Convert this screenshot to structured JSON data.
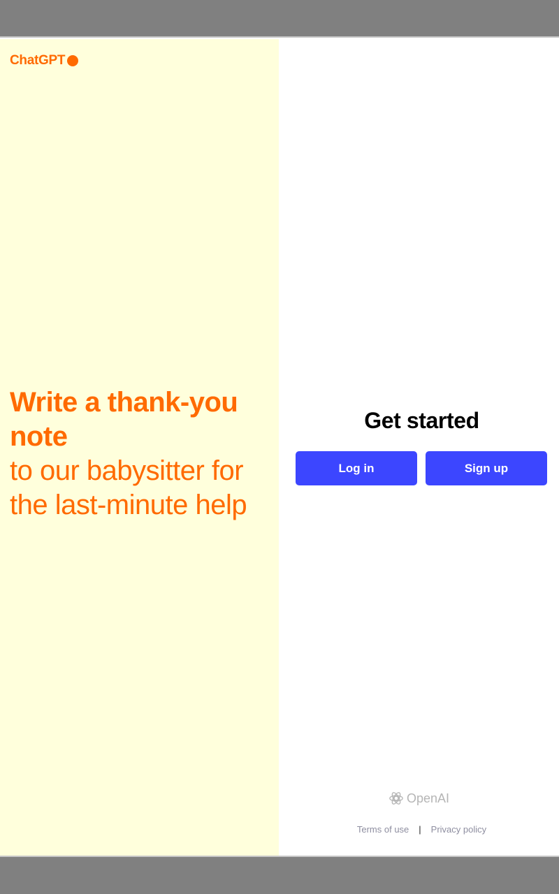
{
  "colors": {
    "accent_orange": "#ff6a00",
    "button_blue": "#3c46ff",
    "left_bg": "#ffffdc"
  },
  "brand": {
    "name": "ChatGPT"
  },
  "prompt": {
    "bold_line": "Write a thank-you note",
    "rest": "to our babysitter for the last-minute help"
  },
  "auth": {
    "heading": "Get started",
    "login_label": "Log in",
    "signup_label": "Sign up"
  },
  "footer": {
    "logo_text": "OpenAI",
    "logo_icon": "openai-logo-icon",
    "terms_label": "Terms of use",
    "separator": "|",
    "privacy_label": "Privacy policy"
  }
}
